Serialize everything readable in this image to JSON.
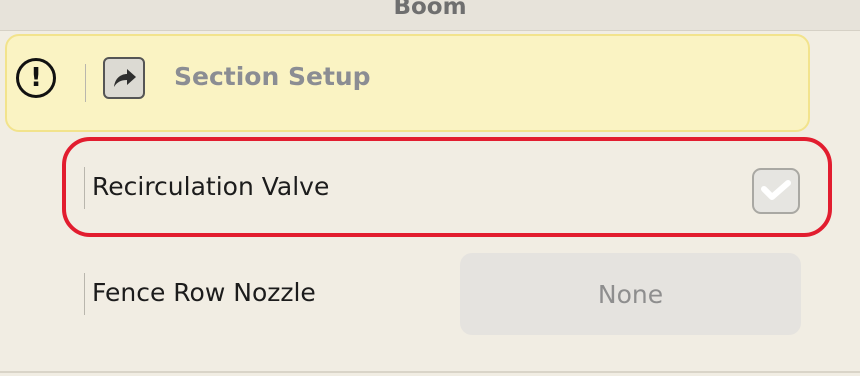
{
  "header": {
    "title": "Boom"
  },
  "section": {
    "title": "Section Setup",
    "alert_icon_glyph": "!",
    "alert_icon": "alert-circle-icon",
    "action_icon": "share-arrow-icon"
  },
  "settings": {
    "recirculation_valve": {
      "label": "Recirculation Valve",
      "checked": true
    },
    "fence_row_nozzle": {
      "label": "Fence Row Nozzle",
      "value": "None"
    }
  },
  "colors": {
    "background": "#f1ede3",
    "alert_bg": "#faf3c3",
    "highlight": "#e21d2f"
  }
}
